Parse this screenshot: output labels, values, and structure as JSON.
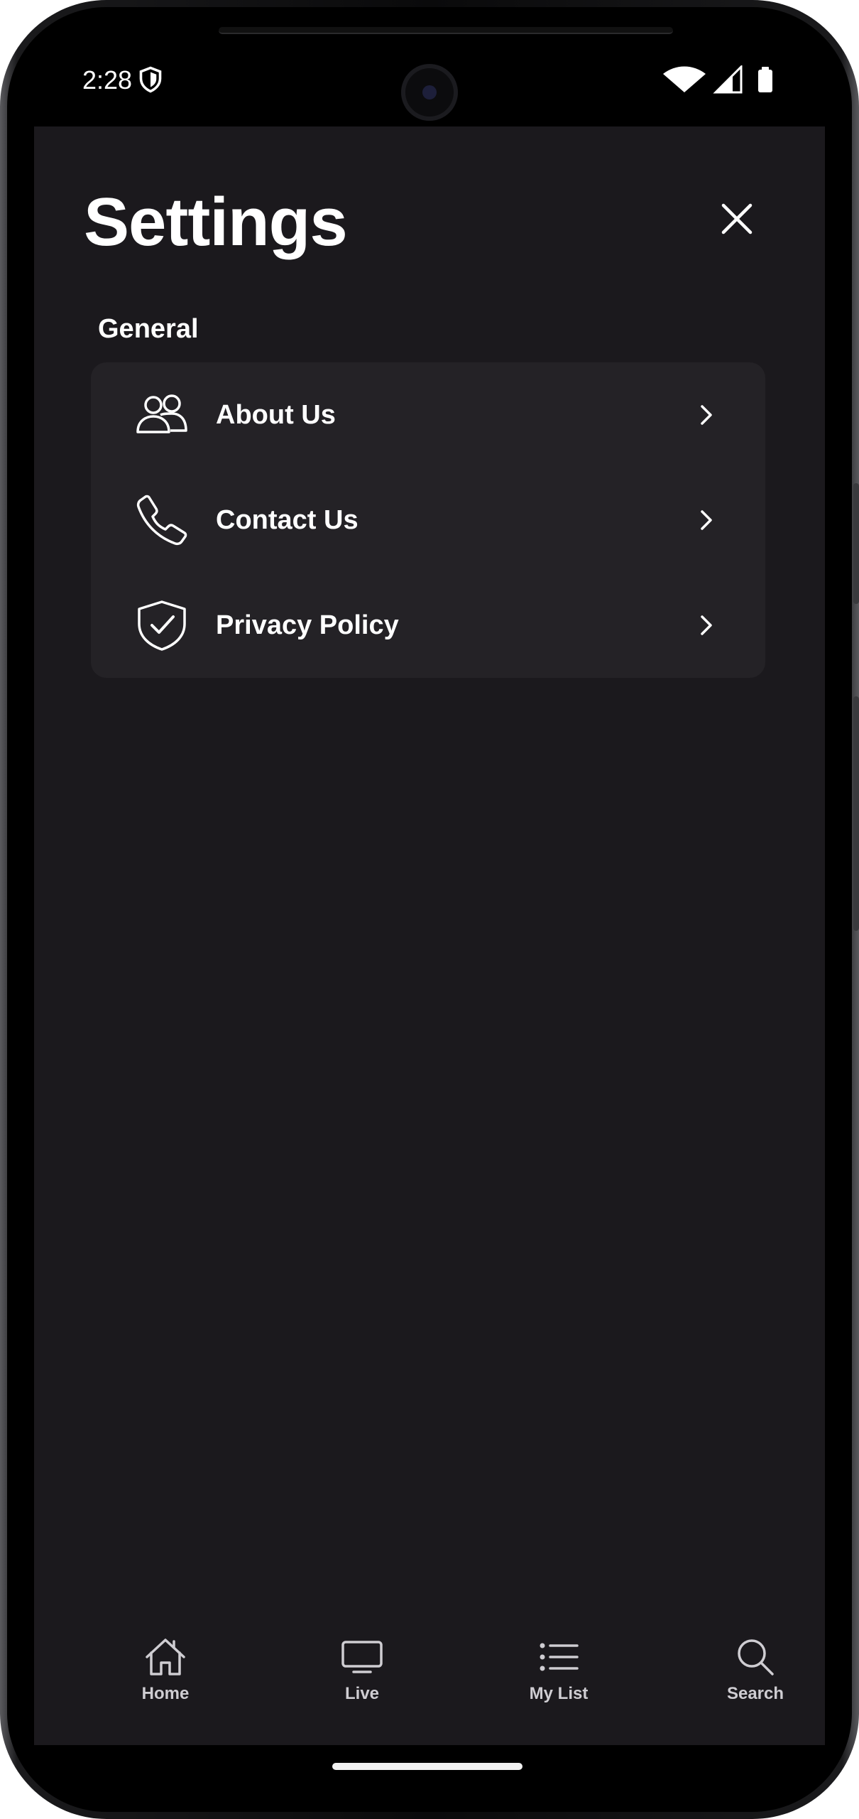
{
  "status_bar": {
    "time": "2:28",
    "icons": [
      "shield-icon",
      "wifi-icon",
      "cell-signal-icon",
      "battery-icon"
    ]
  },
  "header": {
    "title": "Settings",
    "close_icon": "close-icon"
  },
  "sections": [
    {
      "label": "General",
      "items": [
        {
          "label": "About Us",
          "icon": "people-icon"
        },
        {
          "label": "Contact Us",
          "icon": "phone-icon"
        },
        {
          "label": "Privacy Policy",
          "icon": "shield-check-icon"
        }
      ]
    }
  ],
  "tab_bar": {
    "tabs": [
      {
        "label": "Home",
        "icon": "home-icon"
      },
      {
        "label": "Live",
        "icon": "tv-icon"
      },
      {
        "label": "My List",
        "icon": "list-icon"
      },
      {
        "label": "Search",
        "icon": "search-icon"
      }
    ]
  },
  "colors": {
    "background": "#1b191d",
    "card": "#242226",
    "text": "#ffffff",
    "tab_text": "#cfcdd2"
  }
}
